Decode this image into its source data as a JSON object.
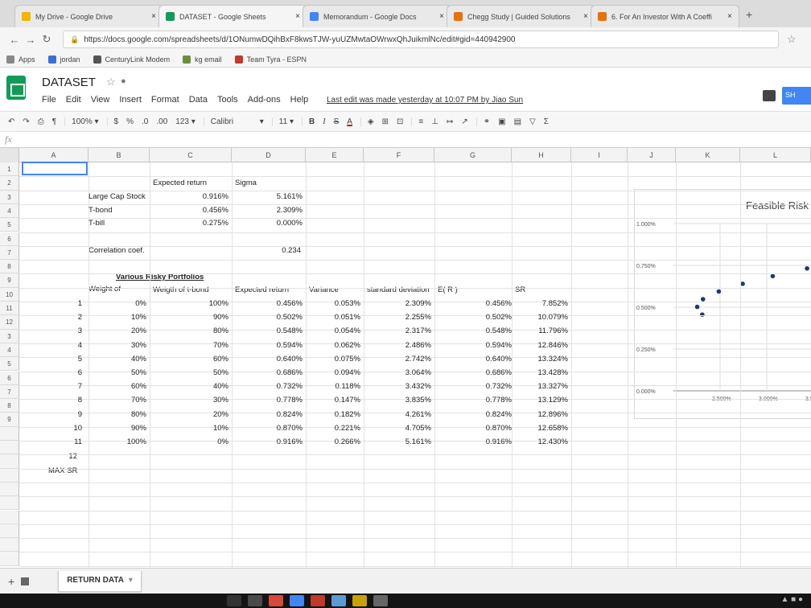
{
  "browser": {
    "tabs": [
      {
        "label": "My Drive - Google Drive",
        "color": "#f4b400",
        "active": false
      },
      {
        "label": "DATASET - Google Sheets",
        "color": "#0f9d58",
        "active": true
      },
      {
        "label": "Memorandum - Google Docs",
        "color": "#4285f4",
        "active": false
      },
      {
        "label": "Chegg Study | Guided Solutions",
        "color": "#e8710a",
        "active": false
      },
      {
        "label": "6. For An Investor With A Coeffi",
        "color": "#e8710a",
        "active": false
      }
    ],
    "url": "https://docs.google.com/spreadsheets/d/1ONumwDQihBxF8kwsTJW-yuUZMwtaOWrwxQhJuikmlNc/edit#gid=440942900",
    "bookmarks": [
      {
        "label": "Apps"
      },
      {
        "label": "jordan"
      },
      {
        "label": "CenturyLink Modem"
      },
      {
        "label": "kg email"
      },
      {
        "label": "Team Tyra - ESPN"
      }
    ]
  },
  "sheets": {
    "title": "DATASET",
    "menus": [
      "File",
      "Edit",
      "View",
      "Insert",
      "Format",
      "Data",
      "Tools",
      "Add-ons",
      "Help"
    ],
    "last_edit": "Last edit was made yesterday at 10:07 PM by Jiao Sun",
    "share_label": "SH",
    "toolbar": {
      "zoom": "100%",
      "currency": "$",
      "percent": "%",
      "dec_less": ".0",
      "dec_more": ".00",
      "format_more": "123",
      "font": "Calibri",
      "font_size": "11",
      "bold": "B",
      "italic": "I",
      "strike": "S",
      "text_color": "A",
      "functions": "Σ"
    },
    "formula_prefix": "fx",
    "columns": [
      "A",
      "B",
      "C",
      "D",
      "E",
      "F",
      "G",
      "H",
      "I",
      "J",
      "K",
      "L"
    ],
    "rows": [
      "1",
      "2",
      "3",
      "4",
      "5",
      "6",
      "7",
      "8",
      "9",
      "10",
      "11",
      "12",
      "3",
      "4",
      "5",
      "6",
      "7",
      "8",
      "9",
      "",
      "",
      "",
      "",
      "",
      "",
      "",
      ""
    ],
    "sheet_tab": "RETURN DATA"
  },
  "cells": {
    "expected_return_hdr": "Expected return",
    "sigma_hdr": "Sigma",
    "assets": [
      {
        "name": "Large Cap Stock",
        "er": "0.916%",
        "sigma": "5.161%"
      },
      {
        "name": "T-bond",
        "er": "0.456%",
        "sigma": "2.309%"
      },
      {
        "name": "T-bill",
        "er": "0.275%",
        "sigma": "0.000%"
      }
    ],
    "corr_label": "Correlation coef.",
    "corr_value": "0.234",
    "portfolios_title": "Various Risky Portfolios",
    "headers": {
      "weight": "Weight of",
      "weight_tbond": "Weigth of t-bond",
      "exp_return": "Expected return",
      "variance": "Variance",
      "std_dev": "standard deviation",
      "er": "E( R )",
      "sr": "SR"
    },
    "portfolios": [
      {
        "n": "1",
        "w": "0%",
        "wt": "100%",
        "er": "0.456%",
        "var": "0.053%",
        "sd": "2.309%",
        "er2": "0.456%",
        "sr": "7.852%"
      },
      {
        "n": "2",
        "w": "10%",
        "wt": "90%",
        "er": "0.502%",
        "var": "0.051%",
        "sd": "2.255%",
        "er2": "0.502%",
        "sr": "10.079%"
      },
      {
        "n": "3",
        "w": "20%",
        "wt": "80%",
        "er": "0.548%",
        "var": "0.054%",
        "sd": "2.317%",
        "er2": "0.548%",
        "sr": "11.796%"
      },
      {
        "n": "4",
        "w": "30%",
        "wt": "70%",
        "er": "0.594%",
        "var": "0.062%",
        "sd": "2.486%",
        "er2": "0.594%",
        "sr": "12.846%"
      },
      {
        "n": "5",
        "w": "40%",
        "wt": "60%",
        "er": "0.640%",
        "var": "0.075%",
        "sd": "2.742%",
        "er2": "0.640%",
        "sr": "13.324%"
      },
      {
        "n": "6",
        "w": "50%",
        "wt": "50%",
        "er": "0.686%",
        "var": "0.094%",
        "sd": "3.064%",
        "er2": "0.686%",
        "sr": "13.428%"
      },
      {
        "n": "7",
        "w": "60%",
        "wt": "40%",
        "er": "0.732%",
        "var": "0.118%",
        "sd": "3.432%",
        "er2": "0.732%",
        "sr": "13.327%"
      },
      {
        "n": "8",
        "w": "70%",
        "wt": "30%",
        "er": "0.778%",
        "var": "0.147%",
        "sd": "3.835%",
        "er2": "0.778%",
        "sr": "13.129%"
      },
      {
        "n": "9",
        "w": "80%",
        "wt": "20%",
        "er": "0.824%",
        "var": "0.182%",
        "sd": "4.261%",
        "er2": "0.824%",
        "sr": "12.896%"
      },
      {
        "n": "10",
        "w": "90%",
        "wt": "10%",
        "er": "0.870%",
        "var": "0.221%",
        "sd": "4.705%",
        "er2": "0.870%",
        "sr": "12.658%"
      },
      {
        "n": "11",
        "w": "100%",
        "wt": "0%",
        "er": "0.916%",
        "var": "0.266%",
        "sd": "5.161%",
        "er2": "0.916%",
        "sr": "12.430%"
      }
    ],
    "row12": "12",
    "max_sr": "MAX SR"
  },
  "chart_data": {
    "type": "scatter",
    "title": "Feasible Risk",
    "x": [
      2.309,
      2.255,
      2.317,
      2.486,
      2.742,
      3.064,
      3.432
    ],
    "y": [
      0.456,
      0.502,
      0.548,
      0.594,
      0.64,
      0.686,
      0.732
    ],
    "xlim": [
      2.0,
      3.5
    ],
    "ylim": [
      0.0,
      1.0
    ],
    "xticks": [
      "2.500%",
      "3.000%",
      "3.500%"
    ],
    "yticks": [
      "0.000%",
      "0.250%",
      "0.500%",
      "0.750%",
      "1.000%"
    ],
    "point_color": "#1f3a73",
    "grid": true
  }
}
